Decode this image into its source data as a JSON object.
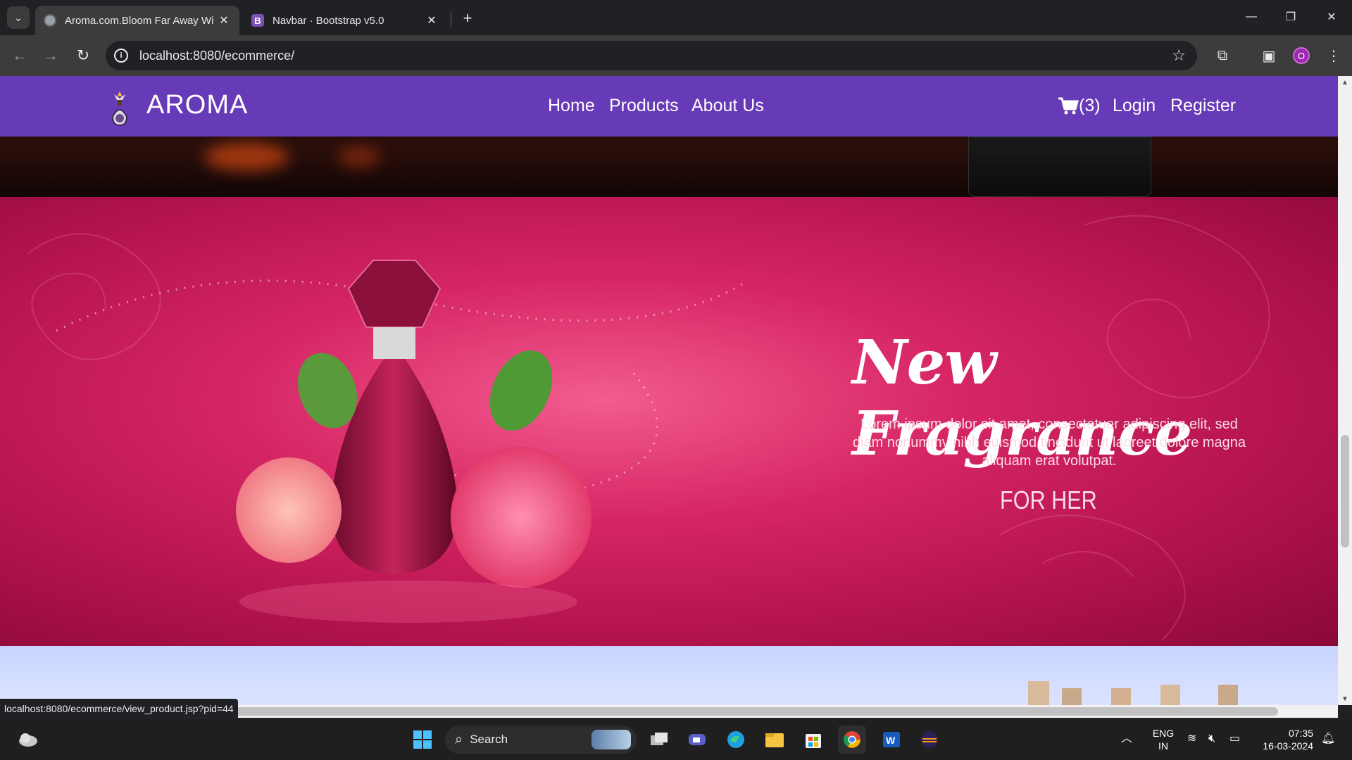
{
  "browser": {
    "tabs": [
      {
        "title": "Aroma.com.Bloom Far Away Wi",
        "active": true
      },
      {
        "title": "Navbar · Bootstrap v5.0",
        "active": false
      }
    ],
    "url": "localhost:8080/ecommerce/",
    "profile_initial": "O",
    "status_url": "localhost:8080/ecommerce/view_product.jsp?pid=44"
  },
  "site": {
    "brand": "AROMA",
    "nav_center": [
      "Home",
      "Products",
      "About Us"
    ],
    "cart_count": "(3)",
    "login": "Login",
    "register": "Register",
    "navbar_color": "#673ab7"
  },
  "banner": {
    "title": "New Fragrance",
    "text": "Lorem ipsum dolor sit amet, consectetuer adipiscing elit, sed diam nonummy nibh euismod tincidunt ut laoreet dolore magna aliquam erat volutpat.",
    "tag": "FOR HER"
  },
  "taskbar": {
    "search_label": "Search",
    "lang_line1": "ENG",
    "lang_line2": "IN",
    "time": "07:35",
    "date": "16-03-2024"
  }
}
